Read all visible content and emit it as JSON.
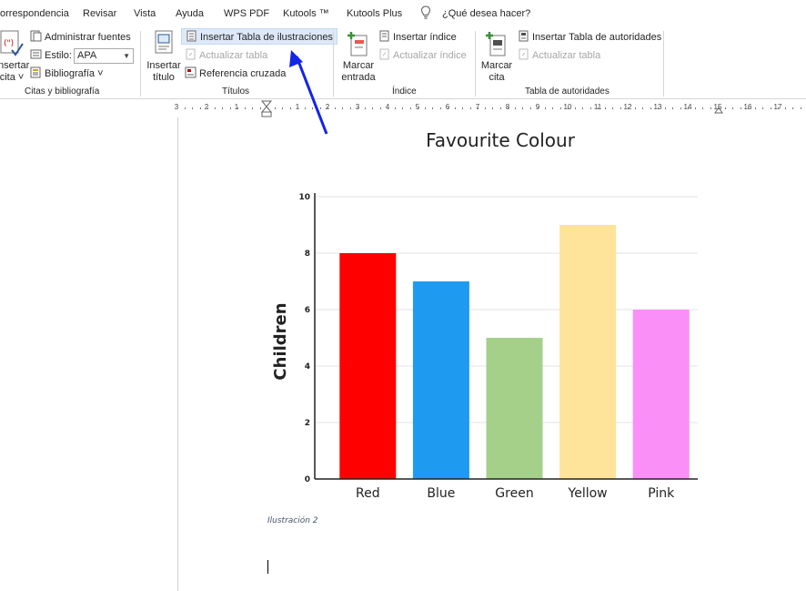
{
  "tabs": [
    "orrespondencia",
    "Revisar",
    "Vista",
    "Ayuda",
    "WPS PDF",
    "Kutools ™",
    "Kutools Plus"
  ],
  "tell_me": "¿Qué desea hacer?",
  "ribbon": {
    "citations": {
      "insert_citation_line1": "nsertar",
      "insert_citation_line2": "cita ˅",
      "manage_sources": "Administrar fuentes",
      "style_label": "Estilo:",
      "style_value": "APA",
      "bibliography": "Bibliografía ˅",
      "group_label": "Citas y bibliografía"
    },
    "captions": {
      "insert_caption_line1": "Insertar",
      "insert_caption_line2": "título",
      "insert_table_of_figures": "Insertar Tabla de ilustraciones",
      "update_table": "Actualizar tabla",
      "cross_reference": "Referencia cruzada",
      "group_label": "Títulos"
    },
    "index": {
      "mark_entry_line1": "Marcar",
      "mark_entry_line2": "entrada",
      "insert_index": "Insertar índice",
      "update_index": "Actualizar índice",
      "group_label": "Índice"
    },
    "authorities": {
      "mark_citation_line1": "Marcar",
      "mark_citation_line2": "cita",
      "insert_table_of_authorities": "Insertar Tabla de autoridades",
      "update_table": "Actualizar tabla",
      "group_label": "Tabla de autoridades"
    }
  },
  "ruler": {
    "left_labels": [
      "3",
      "2",
      "1"
    ],
    "right_labels": [
      "1",
      "2",
      "3",
      "4",
      "5",
      "6",
      "7",
      "8",
      "9",
      "10",
      "11",
      "12",
      "13",
      "14",
      "15",
      "16",
      "17"
    ]
  },
  "chart_data": {
    "type": "bar",
    "title": "Favourite Colour",
    "xlabel": "",
    "ylabel": "Children",
    "categories": [
      "Red",
      "Blue",
      "Green",
      "Yellow",
      "Pink"
    ],
    "values": [
      8,
      7,
      5,
      9,
      6
    ],
    "colors": [
      "#ff0000",
      "#1e9bf0",
      "#a5d08a",
      "#fde49a",
      "#fa8ff8"
    ],
    "ylim": [
      0,
      10
    ],
    "yticks": [
      0,
      2,
      4,
      6,
      8,
      10
    ],
    "grid": true
  },
  "document": {
    "caption": "Ilustración 2"
  },
  "colors": {
    "accent_arrow": "#1424e8",
    "highlight_button": "#dde9f8"
  }
}
